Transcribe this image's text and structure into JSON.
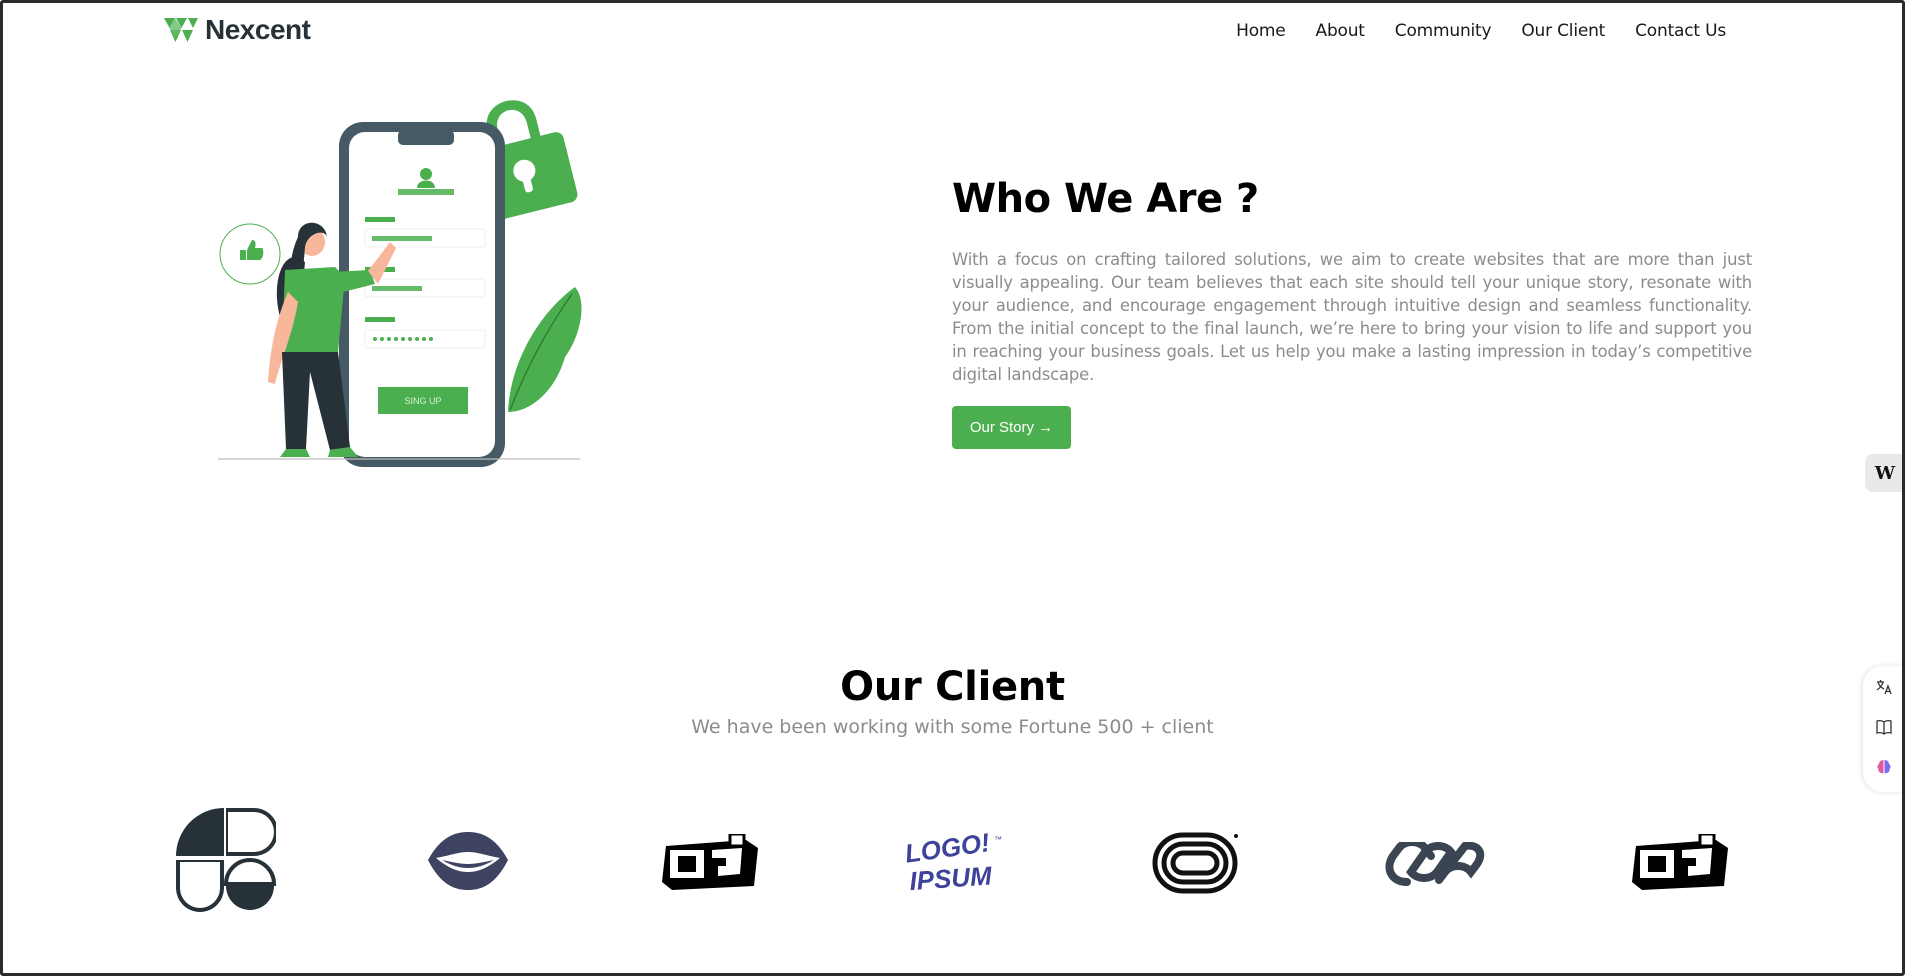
{
  "header": {
    "brand": "Nexcent",
    "nav": [
      "Home",
      "About",
      "Community",
      "Our Client",
      "Contact Us"
    ]
  },
  "illustration": {
    "signup_button": "SING UP"
  },
  "who": {
    "title": "Who We Are ?",
    "body": "With a focus on crafting tailored solutions, we aim to create websites that are more than just visually appealing. Our team believes that each site should tell your unique story, resonate with your audience, and encourage engagement through intuitive design and seamless functionality. From the initial concept to the final launch, we’re here to bring your vision to life and support you in reaching your business goals. Let us help you make a lasting impression in today’s competitive digital landscape.",
    "button": "Our Story →"
  },
  "clients": {
    "title": "Our Client",
    "subtitle": "We have been working with some Fortune 500 + client",
    "logos": [
      "quarter-circles-logo-icon",
      "lips-logo-icon",
      "oj-block-logo-icon",
      "logo-ipsum-logo-icon",
      "concentric-track-logo-icon",
      "infinity-links-logo-icon",
      "oj-block-logo-icon"
    ],
    "logo_text": {
      "ipsum_line1": "LOGO!",
      "ipsum_line2": "IPSUM",
      "tm": "™"
    }
  },
  "side": {
    "widget_letter": "W",
    "tools": [
      "translate-icon",
      "book-icon",
      "brain-icon"
    ]
  },
  "colors": {
    "accent": "#4caf4f",
    "dark": "#263238",
    "text_muted": "#8c8c8c"
  }
}
